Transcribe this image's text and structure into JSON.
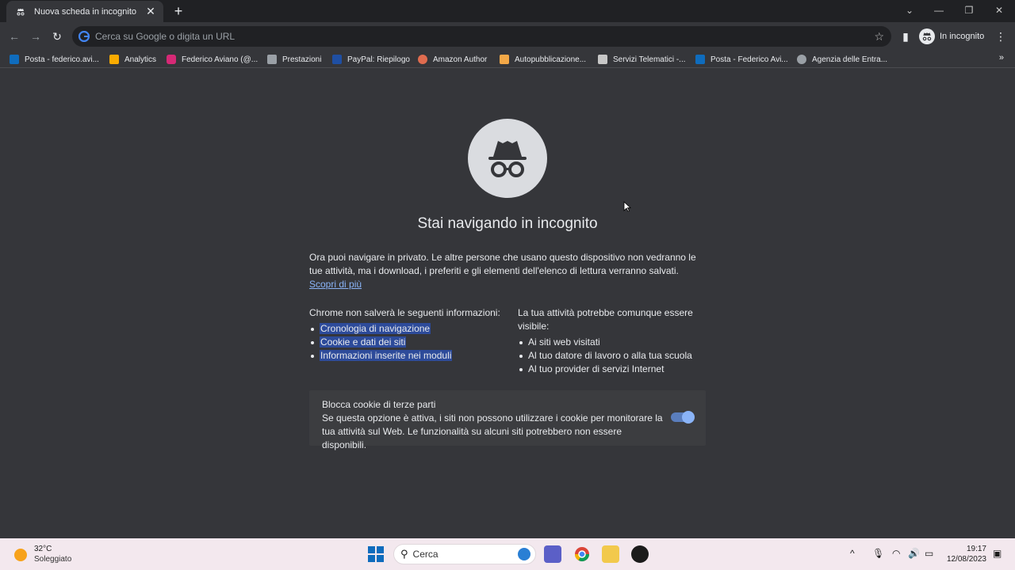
{
  "browser": {
    "tab_title": "Nuova scheda in incognito",
    "omnibox_placeholder": "Cerca su Google o digita un URL",
    "profile_label": "In incognito"
  },
  "bookmarks": [
    {
      "label": "Posta - federico.avi...",
      "color": "#0f6cbd"
    },
    {
      "label": "Analytics",
      "color": "#f9ab00"
    },
    {
      "label": "Federico Aviano (@...",
      "color": "#d62976"
    },
    {
      "label": "Prestazioni",
      "color": "#9aa0a6"
    },
    {
      "label": "PayPal: Riepilogo",
      "color": "#1f4fa3"
    },
    {
      "label": "Amazon Author",
      "color": "#e06c4f"
    },
    {
      "label": "Autopubblicazione...",
      "color": "#f3a847"
    },
    {
      "label": "Servizi Telematici -...",
      "color": "#c7c7c7"
    },
    {
      "label": "Posta - Federico Avi...",
      "color": "#0f6cbd"
    },
    {
      "label": "Agenzia delle Entra...",
      "color": "#9aa0a6"
    }
  ],
  "page": {
    "title": "Stai navigando in incognito",
    "intro": "Ora puoi navigare in privato. Le altre persone che usano questo dispositivo non vedranno le tue attività, ma i download, i preferiti e gli elementi dell'elenco di lettura verranno salvati.",
    "learn_more": "Scopri di più",
    "left_heading": "Chrome non salverà le seguenti informazioni:",
    "left_items": [
      "Cronologia di navigazione",
      "Cookie e dati dei siti",
      "Informazioni inserite nei moduli"
    ],
    "right_heading": "La tua attività potrebbe comunque essere visibile:",
    "right_items": [
      "Ai siti web visitati",
      "Al tuo datore di lavoro o alla tua scuola",
      "Al tuo provider di servizi Internet"
    ],
    "cookie_title": "Blocca cookie di terze parti",
    "cookie_desc": "Se questa opzione è attiva, i siti non possono utilizzare i cookie per monitorare la tua attività sul Web. Le funzionalità su alcuni siti potrebbero non essere disponibili.",
    "cookie_toggle_on": true
  },
  "taskbar": {
    "temp": "32°C",
    "weather": "Soleggiato",
    "search_label": "Cerca",
    "time": "19:17",
    "date": "12/08/2023"
  }
}
